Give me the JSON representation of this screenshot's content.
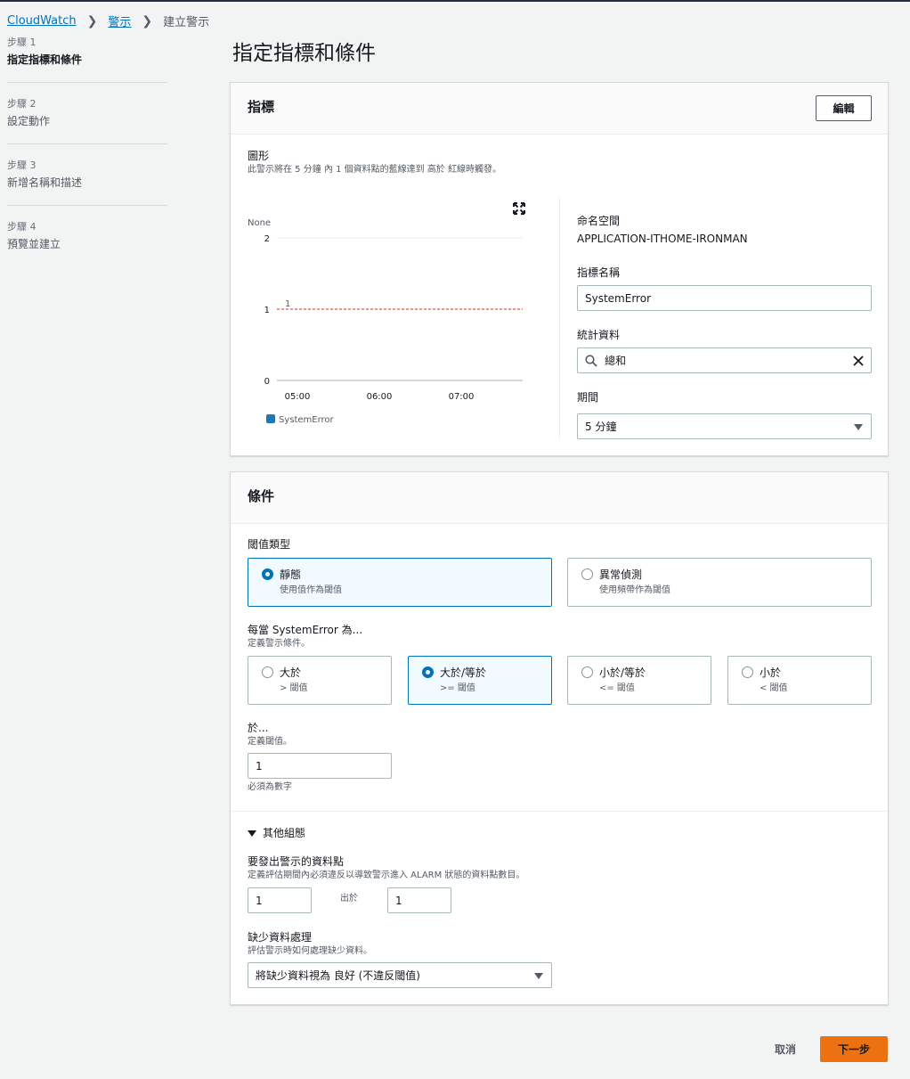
{
  "breadcrumb": {
    "items": [
      "CloudWatch",
      "警示"
    ],
    "current": "建立警示"
  },
  "steps": [
    {
      "num": "步驟 1",
      "name": "指定指標和條件"
    },
    {
      "num": "步驟 2",
      "name": "設定動作"
    },
    {
      "num": "步驟 3",
      "name": "新增名稱和描述"
    },
    {
      "num": "步驟 4",
      "name": "預覽並建立"
    }
  ],
  "page_title": "指定指標和條件",
  "metric_panel": {
    "title": "指標",
    "edit_label": "編輯",
    "graph_label": "圖形",
    "graph_desc": "此警示將在 5 分鐘 內 1 個資料點的藍線達到 高於 紅線時觸發。",
    "namespace_label": "命名空間",
    "namespace_value": "APPLICATION-ITHOME-IRONMAN",
    "metric_name_label": "指標名稱",
    "metric_name_value": "SystemError",
    "statistic_label": "統計資料",
    "statistic_value": "總和",
    "period_label": "期間",
    "period_value": "5 分鐘"
  },
  "chart_data": {
    "type": "line",
    "ylabel": "None",
    "ylim": [
      0,
      2
    ],
    "yticks": [
      "2",
      "1",
      "0"
    ],
    "x": [
      "05:00",
      "06:00",
      "07:00"
    ],
    "threshold": 1,
    "threshold_label": "1",
    "threshold_color": "#d13212",
    "series": [
      {
        "name": "SystemError",
        "color": "#1f77b4",
        "values": []
      }
    ],
    "grid": true,
    "legend": "bottom-left"
  },
  "conditions_panel": {
    "title": "條件",
    "threshold_type_label": "閾值類型",
    "threshold_types": [
      {
        "title": "靜態",
        "desc": "使用值作為閾值",
        "selected": true
      },
      {
        "title": "異常偵測",
        "desc": "使用頻帶作為閾值",
        "selected": false
      }
    ],
    "whenever_label": "每當 SystemError 為...",
    "whenever_desc": "定義警示條件。",
    "operators": [
      {
        "title": "大於",
        "desc": "> 閾值",
        "selected": false
      },
      {
        "title": "大於/等於",
        "desc": ">= 閾值",
        "selected": true
      },
      {
        "title": "小於/等於",
        "desc": "<= 閾值",
        "selected": false
      },
      {
        "title": "小於",
        "desc": "< 閾值",
        "selected": false
      }
    ],
    "than_label": "於...",
    "than_desc": "定義閾值。",
    "than_value": "1",
    "than_hint": "必須為數字",
    "additional_label": "其他組態",
    "datapoints_label": "要發出警示的資料點",
    "datapoints_desc": "定義評估期間內必須違反以導致警示進入 ALARM 狀態的資料點數目。",
    "datapoints_value": "1",
    "out_of_label": "出於",
    "out_of_value": "1",
    "missing_label": "缺少資料處理",
    "missing_desc": "評估警示時如何處理缺少資料。",
    "missing_value": "將缺少資料視為 良好 (不違反閾值)"
  },
  "footer": {
    "cancel_label": "取消",
    "next_label": "下一步"
  }
}
